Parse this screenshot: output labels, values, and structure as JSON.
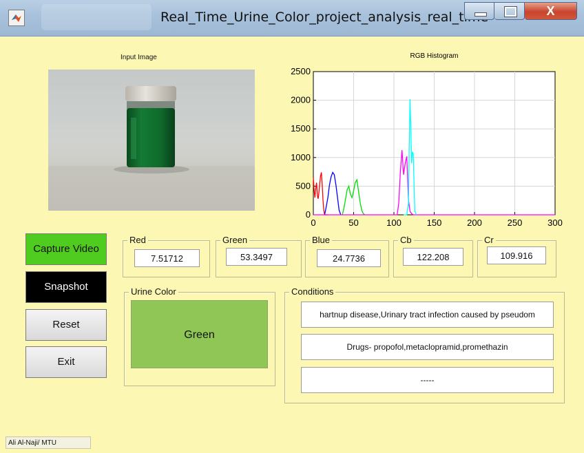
{
  "window": {
    "title": "Real_Time_Urine_Color_project_analysis_real_time",
    "close_label": "X"
  },
  "input_image": {
    "label": "Input Image"
  },
  "histogram": {
    "title": "RGB Histogram"
  },
  "chart_data": {
    "type": "line",
    "title": "RGB Histogram",
    "xlim": [
      0,
      300
    ],
    "ylim": [
      0,
      2500
    ],
    "xticks": [
      0,
      50,
      100,
      150,
      200,
      250,
      300
    ],
    "yticks": [
      0,
      500,
      1000,
      1500,
      2000,
      2500
    ],
    "grid": true,
    "series": [
      {
        "color": "#ff0000",
        "x": [
          0,
          1,
          2,
          3,
          4,
          5,
          6,
          7,
          8,
          9,
          10,
          11,
          12,
          13,
          14,
          15,
          16,
          17,
          18
        ],
        "y": [
          650,
          420,
          300,
          460,
          560,
          330,
          280,
          400,
          560,
          680,
          740,
          520,
          260,
          80,
          0,
          0,
          0,
          0,
          0
        ]
      },
      {
        "color": "#0000ff",
        "x": [
          14,
          16,
          18,
          20,
          22,
          24,
          26,
          28,
          30,
          32,
          34
        ],
        "y": [
          0,
          140,
          300,
          520,
          660,
          740,
          700,
          520,
          300,
          80,
          0
        ]
      },
      {
        "color": "#00dd00",
        "x": [
          36,
          38,
          40,
          42,
          44,
          46,
          48,
          50,
          52,
          54,
          56,
          58,
          60,
          62,
          64
        ],
        "y": [
          0,
          120,
          280,
          440,
          500,
          360,
          300,
          420,
          560,
          610,
          420,
          220,
          80,
          20,
          0
        ]
      },
      {
        "color": "#ff00ff",
        "x": [
          0,
          100,
          104,
          106,
          108,
          110,
          112,
          114,
          116,
          118,
          120,
          122,
          124,
          126,
          128,
          300
        ],
        "y": [
          0,
          0,
          0,
          200,
          760,
          1130,
          700,
          900,
          1020,
          260,
          60,
          20,
          0,
          0,
          0,
          0
        ]
      },
      {
        "color": "#00ffff",
        "x": [
          112,
          116,
          118,
          119,
          120,
          121,
          122,
          123,
          124,
          125,
          126,
          128
        ],
        "y": [
          0,
          0,
          200,
          1200,
          2020,
          1500,
          900,
          1100,
          1060,
          480,
          60,
          0
        ]
      }
    ]
  },
  "channels": [
    {
      "label": "Red",
      "value": "7.51712"
    },
    {
      "label": "Green",
      "value": "53.3497"
    },
    {
      "label": "Blue",
      "value": "24.7736"
    },
    {
      "label": "Cb",
      "value": "122.208"
    },
    {
      "label": "Cr",
      "value": "109.916"
    }
  ],
  "buttons": {
    "capture": "Capture Video",
    "snapshot": "Snapshot",
    "reset": "Reset",
    "exit": "Exit"
  },
  "urine_color": {
    "title": "Urine Color",
    "value": "Green",
    "swatch_color": "#8fc655"
  },
  "conditions": {
    "title": "Conditions",
    "items": [
      "hartnup disease,Urinary tract infection caused by pseudom",
      "Drugs- propofol,metaclopramid,promethazin",
      "-----"
    ]
  },
  "author": "Ali Al-Naji/ MTU"
}
